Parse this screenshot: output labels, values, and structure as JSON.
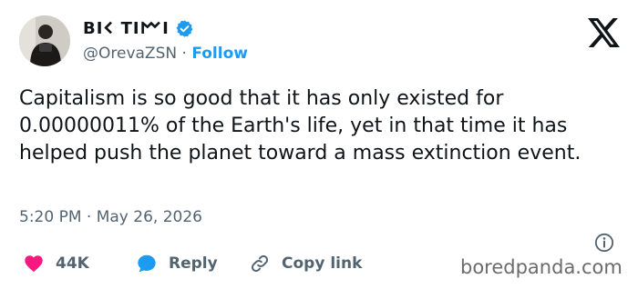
{
  "author": {
    "display_name": "BI𐌂 TI𐌌I",
    "handle": "@OrevaZSN",
    "separator": "·",
    "follow_label": "Follow"
  },
  "tweet": {
    "text": "Capitalism is so good that it has only existed for 0.00000011% of the Earth's life, yet in that time it has helped push the planet toward a mass extinction event.",
    "time": "5:20 PM",
    "separator": "·",
    "date": "May 26, 2026"
  },
  "actions": {
    "like_count": "44K",
    "reply_label": "Reply",
    "copy_link_label": "Copy link"
  },
  "watermark": "boredpanda.com",
  "colors": {
    "accent": "#1d9bf0",
    "like": "#f91880",
    "text": "#0f1419",
    "muted": "#536471"
  },
  "icons": [
    "verified-badge-icon",
    "x-logo-icon",
    "info-icon",
    "heart-icon",
    "reply-bubble-icon",
    "link-icon"
  ]
}
